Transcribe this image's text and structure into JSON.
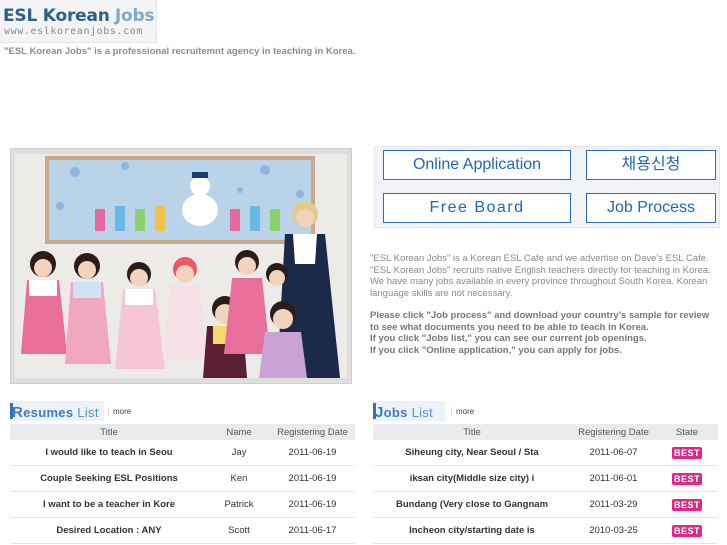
{
  "logo": {
    "title_dark": "ESL Korean",
    "title_light": "Jobs",
    "url": "www.eslkoreanjobs.com"
  },
  "tagline": "\"ESL Korean Jobs\" is a professional recruitemnt agency in teaching in Korea.",
  "buttons": {
    "online_application": "Online Application",
    "apply_korean": "채용신청",
    "free_board": "Free Board",
    "job_process": "Job Process"
  },
  "description": {
    "p1": "\"ESL Korean Jobs\" is a Korean ESL Cafe and we advertise on Dave's ESL Cafe. \"ESL Korean Jobs\" recruits native English teachers directly for teaching in Korea. We have many jobs available in every province throughout South Korea. Korean language skills are not necessary.",
    "p2": "Please click \"Job process\" and download your country's sample for review to see what documents you need to be able to teach in Korea.",
    "p3": "If you click \"Jobs list,\" you can see our current job openings.",
    "p4": "If you click \"Online application,\" you can apply for jobs."
  },
  "resumes": {
    "title_first": "R",
    "title_mid": "esumes",
    "title_rest": "List",
    "more": "more",
    "headers": {
      "title": "Title",
      "name": "Name",
      "date": "Registering Date"
    },
    "rows": [
      {
        "title": "I would like to teach in Seou",
        "name": "Jay",
        "date": "2011-06-19"
      },
      {
        "title": "Couple Seeking ESL Positions",
        "name": "Ken",
        "date": "2011-06-19"
      },
      {
        "title": "I want to be a teacher in Kore",
        "name": "Patrick",
        "date": "2011-06-19"
      },
      {
        "title": "Desired Location : ANY",
        "name": "Scott",
        "date": "2011-06-17"
      }
    ]
  },
  "jobs": {
    "title_first": "J",
    "title_mid": "obs",
    "title_rest": "List",
    "more": "more",
    "headers": {
      "title": "Title",
      "date": "Registering Date",
      "state": "State"
    },
    "rows": [
      {
        "title": "Siheung city, Near Seoul / Sta",
        "date": "2011-06-07",
        "state": "BEST"
      },
      {
        "title": "iksan city(Middle size city) i",
        "date": "2011-06-01",
        "state": "BEST"
      },
      {
        "title": "Bundang (Very close to Gangnam",
        "date": "2011-03-29",
        "state": "BEST"
      },
      {
        "title": "Incheon city/starting date is",
        "date": "2010-03-25",
        "state": "BEST"
      }
    ]
  },
  "colors": {
    "accent": "#1e69b5",
    "best_badge": "#e0288a"
  }
}
